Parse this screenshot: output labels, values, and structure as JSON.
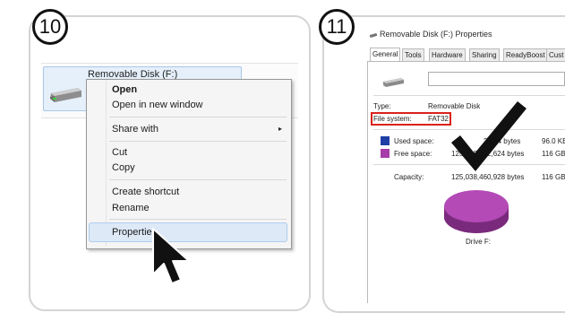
{
  "steps": {
    "step_10": "10",
    "step_11": "11"
  },
  "explorer": {
    "drive_label": "Removable Disk (F:)"
  },
  "context_menu": {
    "items": [
      {
        "label": "Open"
      },
      {
        "label": "Open in new window"
      },
      {
        "label": "Share with"
      },
      {
        "label": "Cut"
      },
      {
        "label": "Copy"
      },
      {
        "label": "Create shortcut"
      },
      {
        "label": "Rename"
      },
      {
        "label": "Properties"
      }
    ],
    "highlighted": "Properties",
    "submenu_arrow": "▸"
  },
  "properties": {
    "title": "Removable Disk (F:) Properties",
    "tabs": [
      "General",
      "Tools",
      "Hardware",
      "Sharing",
      "ReadyBoost",
      "Cust"
    ],
    "active_tab": "General",
    "type_label": "Type:",
    "type_value": "Removable Disk",
    "fs_label": "File system:",
    "fs_value": "FAT32",
    "used_label": "Used space:",
    "used_bytes": "2,304 bytes",
    "used_size": "96.0 KB",
    "free_label": "Free space:",
    "free_bytes": "125,038,362,624 bytes",
    "free_size": "116 GB",
    "capacity_label": "Capacity:",
    "capacity_bytes": "125,038,460,928 bytes",
    "capacity_size": "116 GB",
    "drive_caption": "Drive F:"
  },
  "colors": {
    "used": "#1d3fa6",
    "free": "#a63ca8",
    "highlight_box": "#d9231c"
  }
}
